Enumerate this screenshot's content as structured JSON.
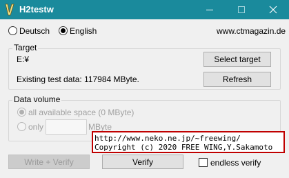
{
  "window": {
    "title": "H2testw",
    "minimize_icon": "minimize-icon",
    "maximize_icon": "maximize-icon",
    "close_icon": "close-icon",
    "titlebar_color": "#1a8a9c"
  },
  "language": {
    "options": [
      "Deutsch",
      "English"
    ],
    "selected": "English",
    "website": "www.ctmagazin.de"
  },
  "target": {
    "legend": "Target",
    "path": "E:¥",
    "existing_data": "Existing test data: 117984 MByte.",
    "select_label": "Select target",
    "refresh_label": "Refresh"
  },
  "data_volume": {
    "legend": "Data volume",
    "all_space_label": "all available space (0 MByte)",
    "only_label": "only",
    "only_value": "",
    "unit": "MByte",
    "selected": "all available space (0 MByte)"
  },
  "actions": {
    "write_verify_label": "Write + Verify",
    "verify_label": "Verify",
    "endless_verify_label": "endless verify",
    "endless_verify_checked": false
  },
  "tooltip": {
    "line1": "http://www.neko.ne.jp/~freewing/",
    "line2": "Copyright (c) 2020 FREE WING,Y.Sakamoto",
    "border_color": "#c00000"
  }
}
